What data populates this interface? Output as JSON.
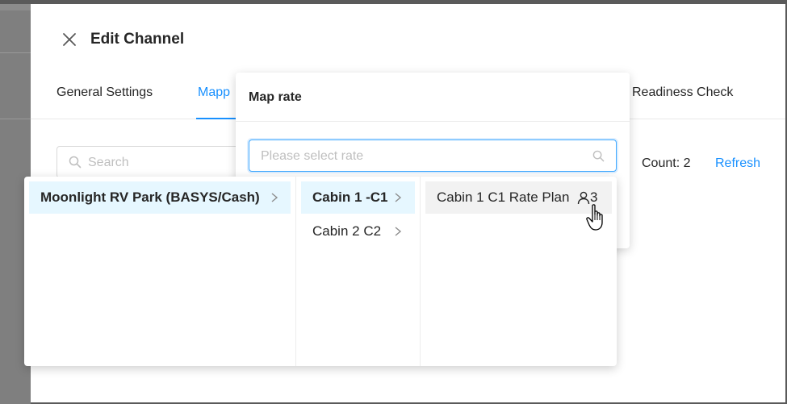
{
  "drawer": {
    "title": "Edit Channel",
    "tabs": [
      {
        "label": "General Settings",
        "active": false
      },
      {
        "label": "Mapp",
        "active": true
      },
      {
        "label": "Readiness Check",
        "active": false
      }
    ],
    "search_placeholder": "Search",
    "count_label": "Count: 2",
    "refresh_label": "Refresh"
  },
  "popover": {
    "title": "Map rate",
    "select_placeholder": "Please select rate"
  },
  "cascader": {
    "columns": [
      [
        {
          "label": "Moonlight RV Park (BASYS/Cash)",
          "has_children": true,
          "state": "active"
        }
      ],
      [
        {
          "label": "Cabin 1 -C1",
          "has_children": true,
          "state": "active"
        },
        {
          "label": "Cabin 2 C2",
          "has_children": true,
          "state": "normal"
        }
      ],
      [
        {
          "label": "Cabin 1 C1 Rate Plan",
          "occupancy": "3",
          "state": "hover"
        }
      ]
    ]
  },
  "colors": {
    "accent": "#1890ff",
    "active_bg": "#e6f7ff",
    "hover_bg": "#f2f2f2",
    "backdrop": "#808080"
  },
  "icons": {
    "close": "close-icon",
    "search": "search-icon",
    "chevron": "chevron-right-icon",
    "occupancy": "user-icon",
    "cursor": "hand-pointer-icon"
  }
}
